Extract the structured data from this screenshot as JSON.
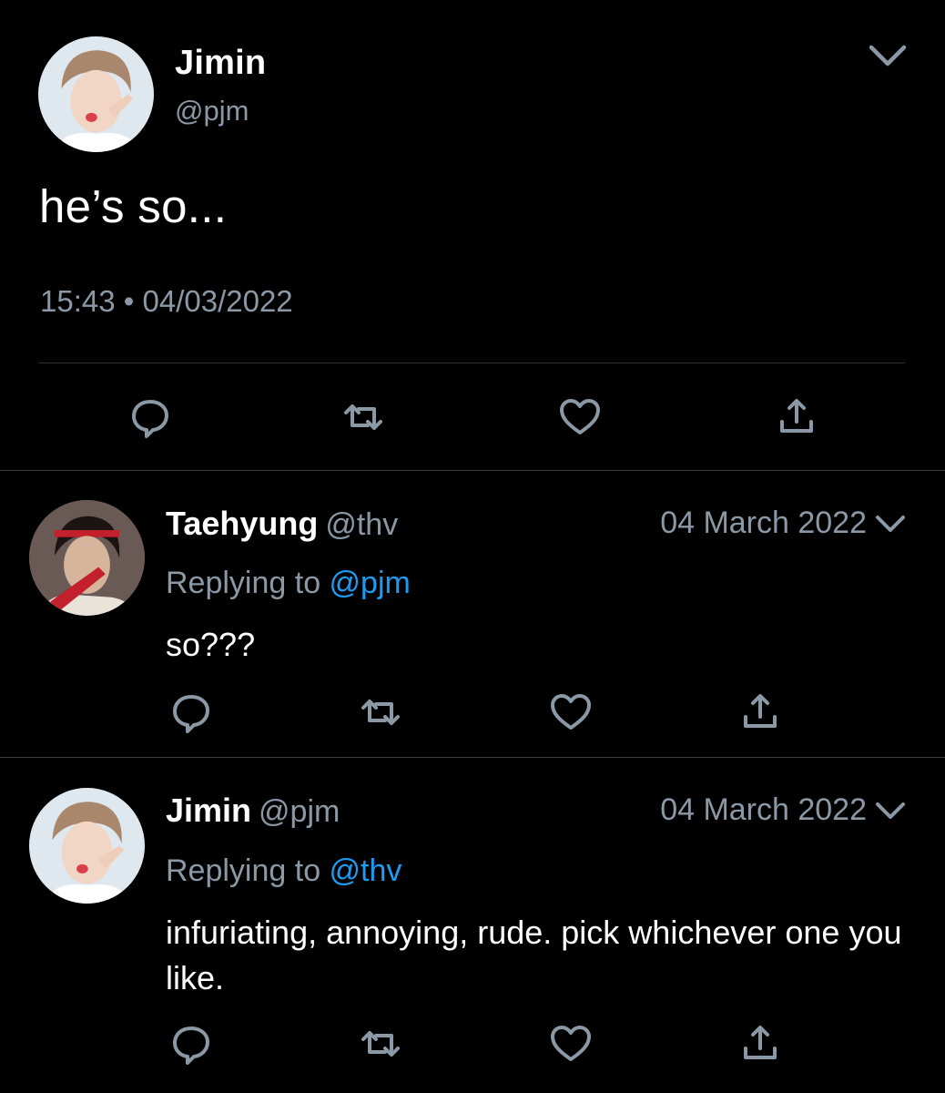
{
  "main_tweet": {
    "author_name": "Jimin",
    "author_handle": "@pjm",
    "text": "he’s so...",
    "time": "15:43",
    "separator": "•",
    "date": "04/03/2022",
    "actions": [
      "reply-icon",
      "retweet-icon",
      "like-icon",
      "share-icon"
    ]
  },
  "replies": [
    {
      "author_name": "Taehyung",
      "author_handle": "@thv",
      "date": "04 March 2022",
      "replying_prefix": "Replying to ",
      "replying_to": "@pjm",
      "text": "so???"
    },
    {
      "author_name": "Jimin",
      "author_handle": "@pjm",
      "date": "04 March 2022",
      "replying_prefix": "Replying to ",
      "replying_to": "@thv",
      "text": "infuriating, annoying, rude. pick whichever one you like."
    }
  ],
  "colors": {
    "background": "#000000",
    "text": "#ffffff",
    "secondary": "#8b98a5",
    "link": "#1d9bf0",
    "divider": "#2f3336"
  }
}
